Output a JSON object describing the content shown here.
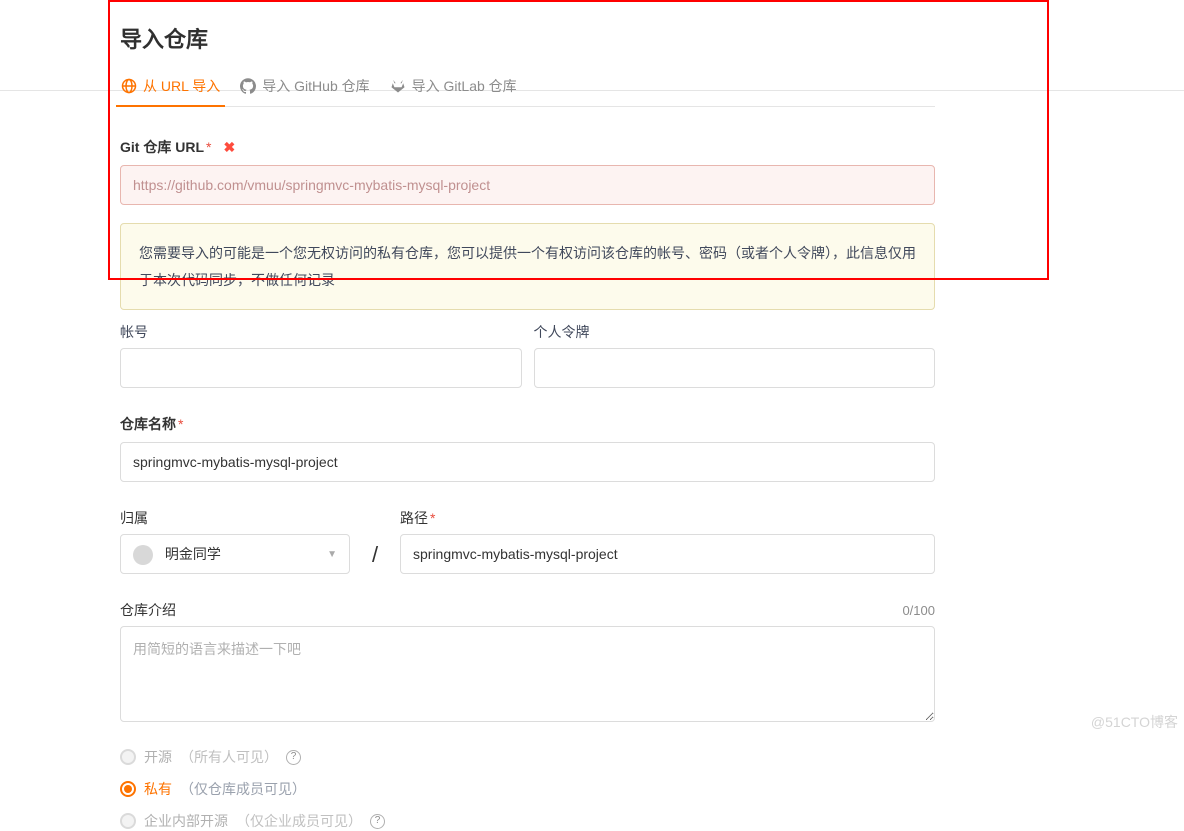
{
  "page_title": "导入仓库",
  "tabs": [
    {
      "label": "从 URL 导入"
    },
    {
      "label": "导入 GitHub 仓库"
    },
    {
      "label": "导入 GitLab 仓库"
    }
  ],
  "git_url_field": {
    "label": "Git 仓库 URL",
    "value": "https://github.com/vmuu/springmvc-mybatis-mysql-project"
  },
  "warning_message": "您需要导入的可能是一个您无权访问的私有仓库，您可以提供一个有权访问该仓库的帐号、密码（或者个人令牌），此信息仅用于本次代码同步，不做任何记录",
  "credentials": {
    "account_label": "帐号",
    "token_label": "个人令牌"
  },
  "repo_name": {
    "label": "仓库名称",
    "value": "springmvc-mybatis-mysql-project"
  },
  "owner": {
    "label": "归属",
    "selected": "明金同学"
  },
  "slash": "/",
  "path": {
    "label": "路径",
    "value": "springmvc-mybatis-mysql-project"
  },
  "description": {
    "label": "仓库介绍",
    "placeholder": "用简短的语言来描述一下吧",
    "counter": "0/100"
  },
  "visibility": {
    "open_source": {
      "label": "开源",
      "hint": "（所有人可见）"
    },
    "private": {
      "label": "私有",
      "hint": "（仅仓库成员可见）"
    },
    "enterprise": {
      "label": "企业内部开源",
      "hint": "（仅企业成员可见）"
    }
  },
  "watermark": "@51CTO博客"
}
